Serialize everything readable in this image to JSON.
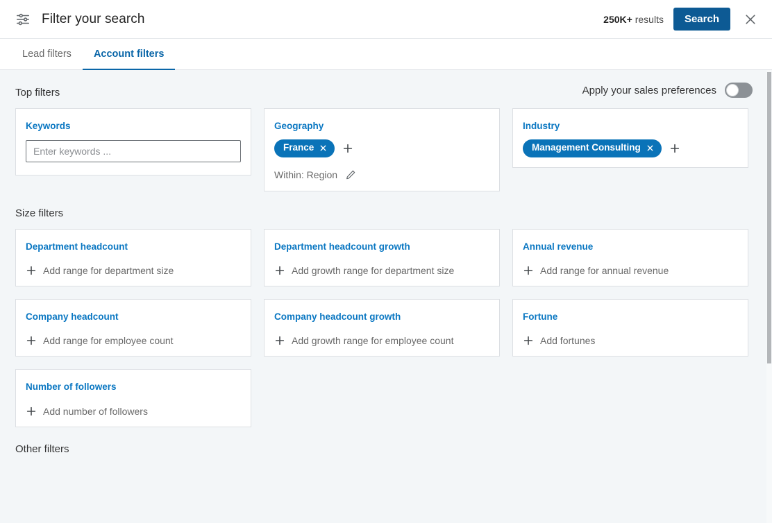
{
  "header": {
    "filter_icon": "sliders-filter-icon",
    "title": "Filter your search",
    "results_count": "250K+",
    "results_suffix": " results",
    "search_label": "Search",
    "close_icon": "close-icon"
  },
  "tabs": [
    {
      "label": "Lead filters",
      "active": false
    },
    {
      "label": "Account filters",
      "active": true
    }
  ],
  "preferences": {
    "label": "Apply your sales preferences",
    "enabled": false
  },
  "sections": {
    "top_filters_title": "Top filters",
    "size_filters_title": "Size filters",
    "other_filters_title": "Other filters"
  },
  "top_filters": {
    "keywords": {
      "label": "Keywords",
      "placeholder": "Enter keywords ...",
      "value": ""
    },
    "geography": {
      "label": "Geography",
      "pill": "France",
      "add_icon": "plus-icon",
      "within_text": "Within: Region",
      "edit_icon": "pencil-edit-icon"
    },
    "industry": {
      "label": "Industry",
      "pill": "Management Consulting",
      "add_icon": "plus-icon"
    }
  },
  "size_filters": [
    {
      "label": "Department headcount",
      "add_text": "Add range for department size"
    },
    {
      "label": "Department headcount growth",
      "add_text": "Add growth range for department size"
    },
    {
      "label": "Annual revenue",
      "add_text": "Add range for annual revenue"
    },
    {
      "label": "Company headcount",
      "add_text": "Add range for employee count"
    },
    {
      "label": "Company headcount growth",
      "add_text": "Add growth range for employee count"
    },
    {
      "label": "Fortune",
      "add_text": "Add fortunes"
    },
    {
      "label": "Number of followers",
      "add_text": "Add number of followers"
    }
  ],
  "colors": {
    "accent_blue": "#0a77c2",
    "pill_blue": "#0a73b8",
    "search_button": "#0d5a94",
    "page_bg": "#f3f6f8"
  }
}
